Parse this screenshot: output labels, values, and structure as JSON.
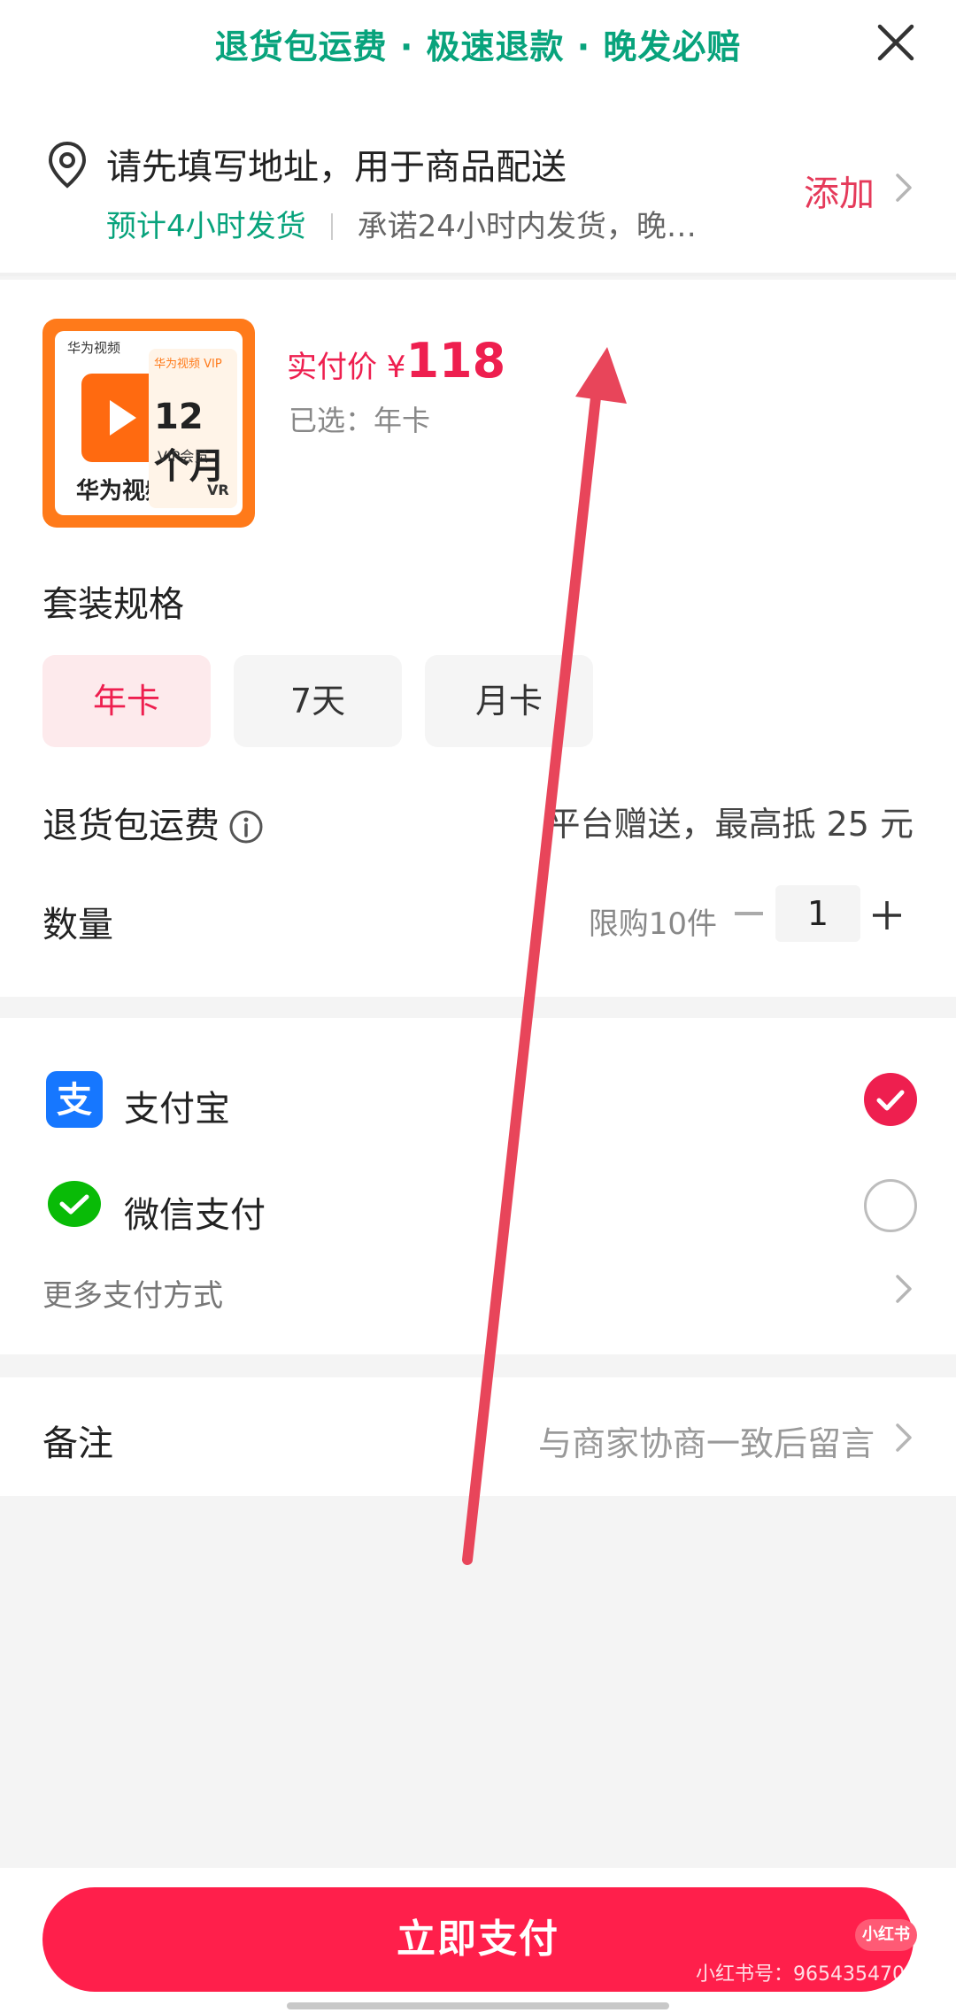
{
  "banner": {
    "text": "退货包运费 · 极速退款 · 晚发必赔"
  },
  "address": {
    "title": "请先填写地址，用于商品配送",
    "eta": "预计4小时发货",
    "promise": "承诺24小时内发货，晚…",
    "add_label": "添加"
  },
  "product": {
    "thumb": {
      "brand": "华为视频",
      "side_header": "华为视频 VIP",
      "months": "12个月",
      "vip": "VIP会员",
      "devices": "VR"
    },
    "price_label": "实付价 ¥",
    "price": "118",
    "selected": "已选：年卡"
  },
  "spec": {
    "title": "套装规格",
    "options": [
      {
        "label": "年卡",
        "active": true
      },
      {
        "label": "7天",
        "active": false
      },
      {
        "label": "月卡",
        "active": false
      }
    ]
  },
  "return_shipping": {
    "label": "退货包运费",
    "value": "平台赠送，最高抵 25 元"
  },
  "quantity": {
    "label": "数量",
    "limit": "限购10件",
    "value": "1"
  },
  "payment": {
    "methods": [
      {
        "name": "支付宝",
        "selected": true
      },
      {
        "name": "微信支付",
        "selected": false
      }
    ],
    "more": "更多支付方式"
  },
  "remark": {
    "label": "备注",
    "hint": "与商家协商一致后留言"
  },
  "pay_button": {
    "label": "立即支付"
  },
  "watermark": {
    "logo": "小红书",
    "text": "小红书号：9654354704"
  },
  "colors": {
    "accent": "#ff1f4b",
    "green": "#08a37c",
    "alipay": "#1677ff",
    "wechat": "#09bb07"
  }
}
